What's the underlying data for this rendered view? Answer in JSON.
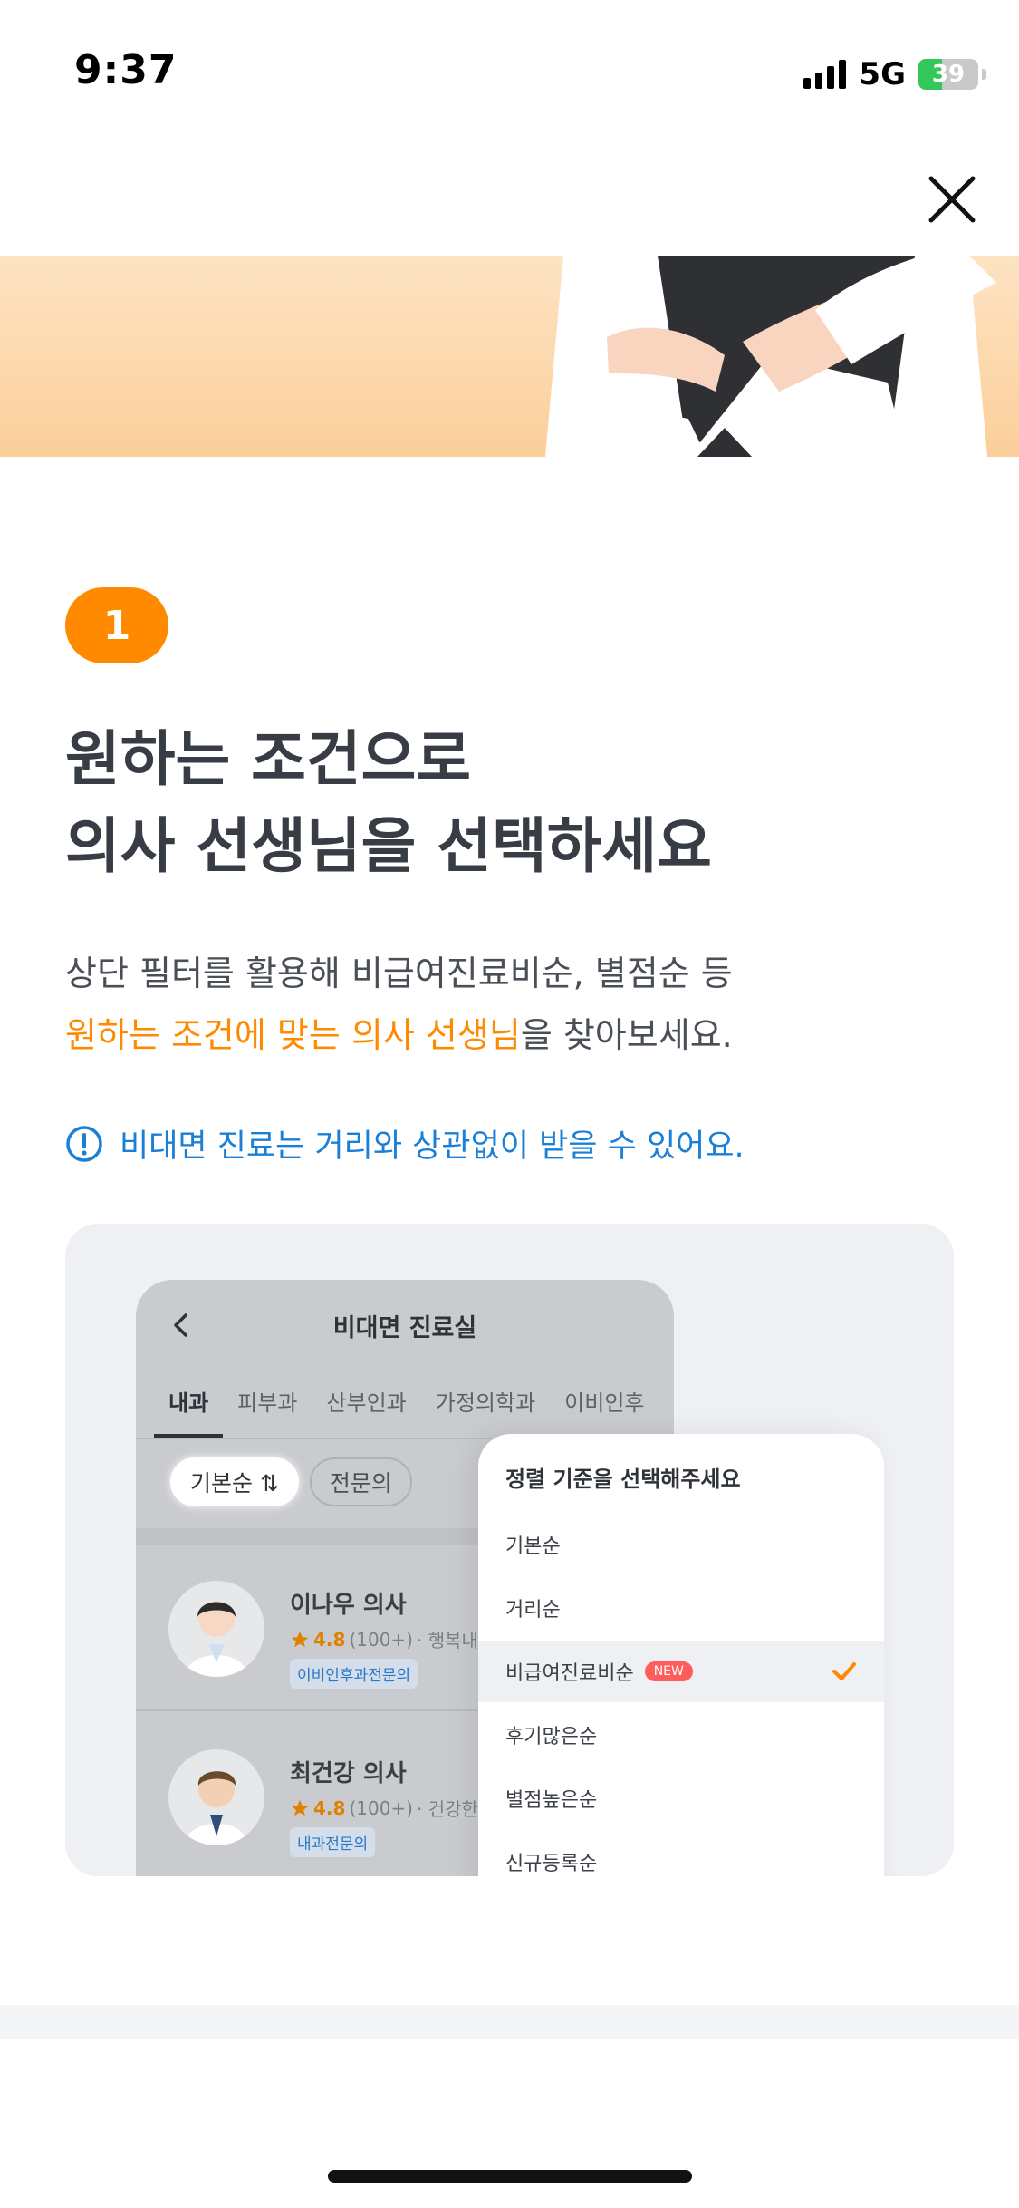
{
  "status_bar": {
    "time": "9:37",
    "network": "5G",
    "battery_level": "39",
    "battery_fraction": 0.39,
    "icons": [
      "signal-icon",
      "battery-icon"
    ]
  },
  "header": {
    "close_icon": "close-icon"
  },
  "step": {
    "number": "1"
  },
  "title": {
    "line1": "원하는 조건으로",
    "line2": "의사 선생님을 선택하세요"
  },
  "description": {
    "line1": "상단 필터를 활용해 비급여진료비순, 별점순 등",
    "line2_highlight": "원하는 조건에 맞는 의사 선생님",
    "line2_rest": "을 찾아보세요."
  },
  "notice": {
    "icon": "info-icon",
    "text": "비대면 진료는 거리와 상관없이 받을 수 있어요."
  },
  "preview": {
    "title": "비대면 진료실",
    "tabs": [
      "내과",
      "피부과",
      "산부인과",
      "가정의학과",
      "이비인후"
    ],
    "filters": {
      "sort": "기본순 ⇅",
      "specialist": "전문의"
    },
    "doctors": [
      {
        "name": "이나우 의사",
        "rating": "4.8",
        "reviews": "(100+)",
        "hospital": "· 행복내과",
        "specialty": "이비인후과전문의"
      },
      {
        "name": "최건강 의사",
        "rating": "4.8",
        "reviews": "(100+)",
        "hospital": "· 건강한내과",
        "specialty": "내과전문의"
      }
    ],
    "sort_sheet": {
      "title": "정렬 기준을 선택해주세요",
      "options": [
        "기본순",
        "거리순",
        "비급여진료비순",
        "후기많은순",
        "별점높은순",
        "신규등록순"
      ],
      "selected": "비급여진료비순",
      "new_badge": "NEW"
    }
  },
  "colors": {
    "accent": "#ff8a00",
    "notice": "#1a7fd6",
    "title": "#373c45"
  }
}
